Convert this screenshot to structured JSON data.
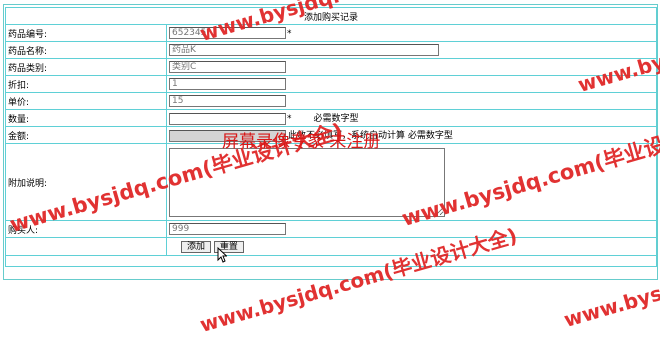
{
  "form": {
    "title": "添加购买记录",
    "fields": {
      "drug_id": {
        "label": "药品编号:",
        "value": "652345",
        "suffix": "*"
      },
      "drug_name": {
        "label": "药品名称:",
        "value": "药品K"
      },
      "drug_category": {
        "label": "药品类别:",
        "value": "类别C"
      },
      "discount": {
        "label": "折扣:",
        "value": "1"
      },
      "unit_price": {
        "label": "单价:",
        "value": "15"
      },
      "quantity": {
        "label": "数量:",
        "value": "",
        "suffix": "*",
        "hint": "必需数字型"
      },
      "amount": {
        "label": "金额:",
        "value": "",
        "note": "此数不必填写，系统自动计算  必需数字型"
      },
      "remark": {
        "label": "附加说明:",
        "value": ""
      },
      "buyer": {
        "label": "购买人:",
        "value": "999"
      }
    },
    "buttons": {
      "add": "添加",
      "reset": "重置"
    }
  },
  "watermarks": {
    "url_text": "www.bysjdq.com(毕业设计大全)",
    "recorder_text": "屏幕录像专家  未注册"
  },
  "colors": {
    "border": "#5fd0d6",
    "watermark": "#e02828"
  },
  "icons": {
    "cursor": "mouse-pointer-icon"
  }
}
